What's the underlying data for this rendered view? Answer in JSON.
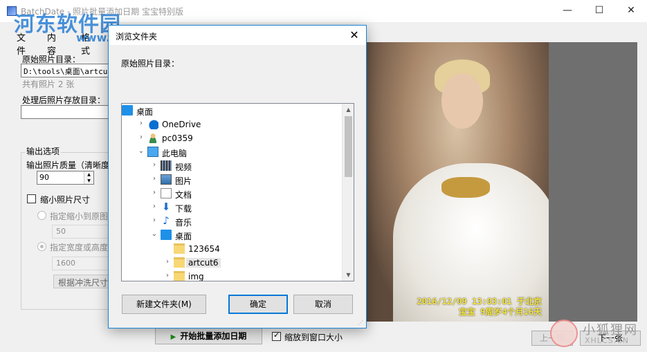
{
  "window": {
    "title": "BatchDate - 照片批量添加日期 宝宝特别版",
    "minimize_glyph": "—",
    "maximize_glyph": "☐",
    "close_glyph": "✕"
  },
  "watermarks": {
    "site_logo": "河东软件园",
    "site_url": "www.pc0359.cn",
    "fox_text": "小狐狸网",
    "fox_sub": "XHLCS.CN"
  },
  "menu": [
    "文件",
    "内容",
    "格式"
  ],
  "left": {
    "source_label": "原始照片目录：",
    "source_value": "D:\\tools\\桌面\\artcut6",
    "photo_count": "共有照片 2 张",
    "output_label": "处理后照片存放目录：",
    "output_value": "",
    "output_group": "输出选项",
    "quality_label": "输出照片质量（清晰度",
    "quality_value": "90",
    "shrink_label": "缩小照片尺寸",
    "shrink_checked": false,
    "ratio_label": "指定缩小到原图的",
    "ratio_value": "50",
    "size_label": "指定宽度或高度的",
    "size_value": "1600",
    "print_button": "根据冲洗尺寸"
  },
  "preview": {
    "stamp_line1": "2016/12/09 13:03:01 于北京",
    "stamp_line2": "宝宝 9周岁4个月16天"
  },
  "bottom": {
    "start_button": "开始批量添加日期",
    "fit_label": "缩放到窗口大小",
    "fit_checked": true,
    "prev_button": "上一张",
    "next_button": "下一张"
  },
  "dialog": {
    "title": "浏览文件夹",
    "prompt": "原始照片目录：",
    "tree": [
      {
        "label": "桌面",
        "icon": "desktop-icon",
        "expander": "",
        "indent": 0
      },
      {
        "label": "OneDrive",
        "icon": "cloud-icon",
        "expander": "›",
        "indent": 1
      },
      {
        "label": "pc0359",
        "icon": "user-icon",
        "expander": "›",
        "indent": 1
      },
      {
        "label": "此电脑",
        "icon": "computer-icon",
        "expander": "⌄",
        "indent": 1
      },
      {
        "label": "视频",
        "icon": "video-icon",
        "expander": "›",
        "indent": 2
      },
      {
        "label": "图片",
        "icon": "pictures-icon",
        "expander": "›",
        "indent": 2
      },
      {
        "label": "文档",
        "icon": "documents-icon",
        "expander": "›",
        "indent": 2
      },
      {
        "label": "下载",
        "icon": "download-icon",
        "expander": "›",
        "indent": 2
      },
      {
        "label": "音乐",
        "icon": "music-icon",
        "expander": "›",
        "indent": 2
      },
      {
        "label": "桌面",
        "icon": "desktop-icon",
        "expander": "⌄",
        "indent": 2
      },
      {
        "label": "123654",
        "icon": "folder-icon",
        "expander": "",
        "indent": 3
      },
      {
        "label": "artcut6",
        "icon": "folder-icon",
        "expander": "›",
        "indent": 3,
        "selected": true
      },
      {
        "label": "img",
        "icon": "folder-icon",
        "expander": "›",
        "indent": 3
      }
    ],
    "new_folder_button": "新建文件夹(M)",
    "ok_button": "确定",
    "cancel_button": "取消"
  }
}
